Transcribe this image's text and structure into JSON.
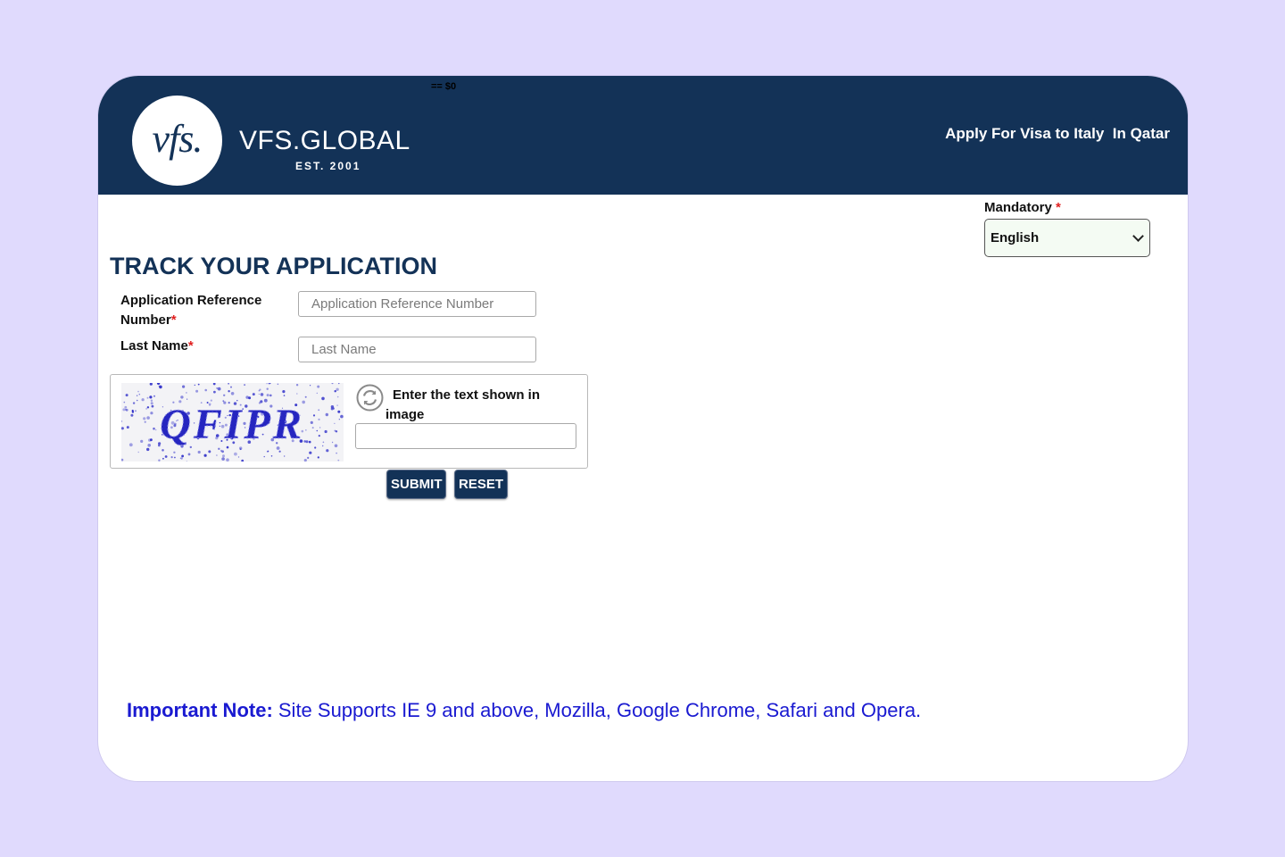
{
  "header": {
    "devtools_marker": "== $0",
    "logo_text": "vfs.",
    "brand_name": "VFS.GLOBAL",
    "brand_est": "EST. 2001",
    "tagline": "Apply For Visa to Italy  In Qatar"
  },
  "language": {
    "label": "Mandatory",
    "required_marker": "*",
    "selected": "English"
  },
  "form": {
    "title": "TRACK YOUR APPLICATION",
    "ref_label": "Application Reference Number",
    "ref_placeholder": "Application Reference Number",
    "lastname_label": "Last Name",
    "lastname_placeholder": "Last Name",
    "required_marker": "*"
  },
  "captcha": {
    "image_text": "QFIPR",
    "prompt": "Enter the text shown in image"
  },
  "buttons": {
    "submit": "SUBMIT",
    "reset": "RESET"
  },
  "note": {
    "label": "Important Note:",
    "text": " Site Supports IE 9 and above, Mozilla, Google Chrome, Safari and Opera."
  },
  "colors": {
    "navy": "#133257",
    "page_bg": "#e0dafd",
    "note_blue": "#1a1ad1",
    "required_red": "#e02020",
    "captcha_text": "#2b2bc8"
  }
}
